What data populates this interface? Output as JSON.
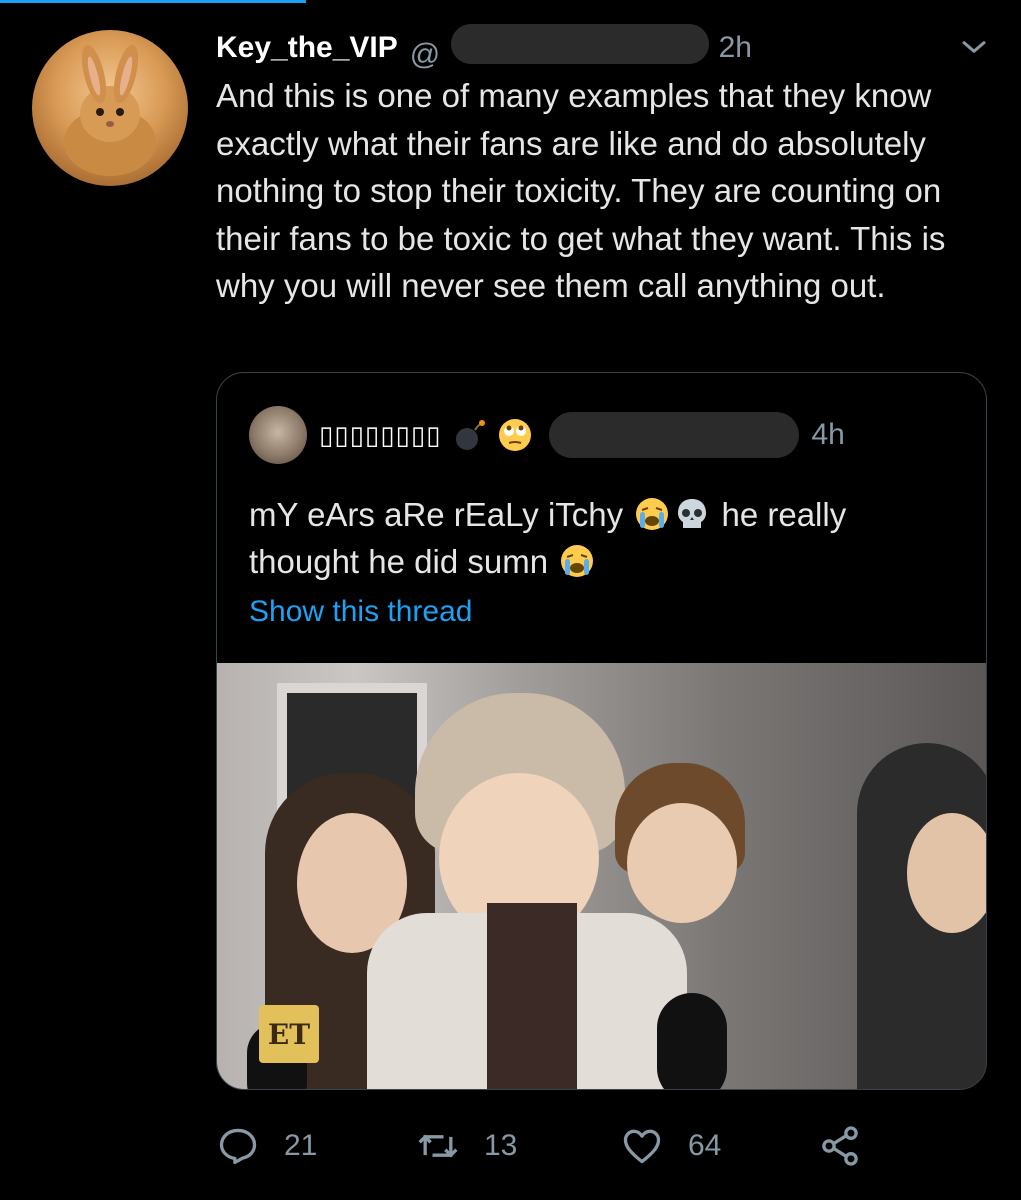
{
  "tweet": {
    "display_name": "Key_the_VIP",
    "handle_prefix": "@",
    "time": "2h",
    "text": "And this is one of many examples that they know exactly what their fans are like and do absolutely nothing to stop their toxicity. They are counting on their fans to be toxic to get what they want. This is why you will never see them call anything out.",
    "actions": {
      "reply_count": "21",
      "retweet_count": "13",
      "like_count": "64"
    }
  },
  "quoted_tweet": {
    "display_name": "▯▯▯▯▯▯▯▯",
    "time": "4h",
    "text_part1": "mY eArs aRe rEaLy iTchy",
    "text_part2": "he really thought he did sumn",
    "show_thread": "Show this thread",
    "media_watermark": "ET"
  },
  "icons": {
    "menu": "chevron-down-icon",
    "reply": "reply-icon",
    "retweet": "retweet-icon",
    "like": "heart-icon",
    "share": "share-icon"
  },
  "colors": {
    "background": "#000000",
    "accent": "#1da1f2",
    "secondary_text": "#8899a6",
    "border": "#38444d"
  }
}
